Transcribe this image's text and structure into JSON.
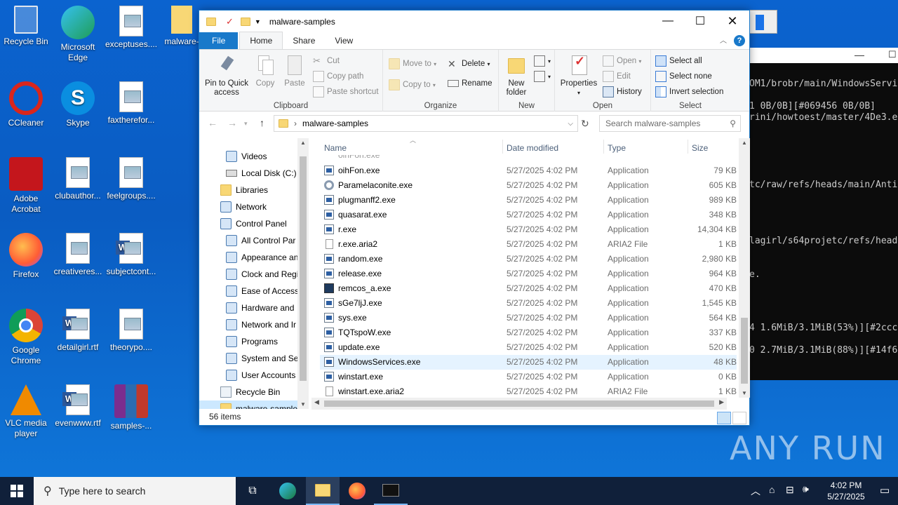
{
  "desktop": {
    "icons": [
      {
        "label": "Recycle Bin",
        "icon": "recycle-bin-icon"
      },
      {
        "label": "Microsoft Edge",
        "icon": "edge-icon"
      },
      {
        "label": "exceptuses....",
        "icon": "image-file-icon"
      },
      {
        "label": "malware-",
        "icon": "folder-icon"
      },
      {
        "label": "CCleaner",
        "icon": "ccleaner-icon"
      },
      {
        "label": "Skype",
        "icon": "skype-icon"
      },
      {
        "label": "faxtherefor...",
        "icon": "image-file-icon"
      },
      {
        "label": "Adobe Acrobat",
        "icon": "acrobat-icon"
      },
      {
        "label": "clubauthor...",
        "icon": "image-file-icon"
      },
      {
        "label": "feelgroups....",
        "icon": "image-file-icon"
      },
      {
        "label": "Firefox",
        "icon": "firefox-icon"
      },
      {
        "label": "creativeres...",
        "icon": "image-file-icon"
      },
      {
        "label": "subjectcont...",
        "icon": "word-doc-icon"
      },
      {
        "label": "Google Chrome",
        "icon": "chrome-icon"
      },
      {
        "label": "detailgirl.rtf",
        "icon": "word-doc-icon"
      },
      {
        "label": "theorypo....",
        "icon": "image-file-icon"
      },
      {
        "label": "VLC media player",
        "icon": "vlc-icon"
      },
      {
        "label": "evenwww.rtf",
        "icon": "word-doc-icon"
      },
      {
        "label": "samples-...",
        "icon": "winrar-icon"
      }
    ]
  },
  "terminal": {
    "lines": [
      "OM1/brobr/main/WindowsServi",
      "1 0B/0B][#069456 0B/0B]",
      "rini/howtoest/master/4De3.e",
      "tc/raw/refs/heads/main/Anti",
      "lagirl/s64projetc/refs/head",
      "e.",
      "4 1.6MiB/3.1MiB(53%)][#2ccc",
      "0 2.7MiB/3.1MiB(88%)][#14f6"
    ]
  },
  "explorer": {
    "title": "malware-samples",
    "tabs": [
      "File",
      "Home",
      "Share",
      "View"
    ],
    "ribbon": {
      "clipboard": {
        "label": "Clipboard",
        "pin": "Pin to Quick access",
        "copy": "Copy",
        "paste": "Paste",
        "cut": "Cut",
        "copy_path": "Copy path",
        "paste_shortcut": "Paste shortcut"
      },
      "organize": {
        "label": "Organize",
        "move_to": "Move to",
        "copy_to": "Copy to",
        "delete": "Delete",
        "rename": "Rename"
      },
      "new": {
        "label": "New",
        "new_folder": "New folder"
      },
      "open": {
        "label": "Open",
        "properties": "Properties",
        "open": "Open",
        "edit": "Edit",
        "history": "History"
      },
      "select": {
        "label": "Select",
        "select_all": "Select all",
        "select_none": "Select none",
        "invert": "Invert selection"
      }
    },
    "address": {
      "path": "malware-samples",
      "search_placeholder": "Search malware-samples"
    },
    "nav": [
      {
        "label": "Videos",
        "indent": 1,
        "icon": "videos-icon"
      },
      {
        "label": "Local Disk (C:)",
        "indent": 1,
        "icon": "drive-icon"
      },
      {
        "label": "Libraries",
        "indent": 0,
        "icon": "libraries-icon"
      },
      {
        "label": "Network",
        "indent": 0,
        "icon": "network-icon"
      },
      {
        "label": "Control Panel",
        "indent": 0,
        "icon": "control-panel-icon"
      },
      {
        "label": "All Control Par",
        "indent": 1,
        "icon": "control-panel-icon"
      },
      {
        "label": "Appearance an",
        "indent": 1,
        "icon": "appearance-icon"
      },
      {
        "label": "Clock and Regi",
        "indent": 1,
        "icon": "clock-icon"
      },
      {
        "label": "Ease of Access",
        "indent": 1,
        "icon": "ease-of-access-icon"
      },
      {
        "label": "Hardware and",
        "indent": 1,
        "icon": "hardware-icon"
      },
      {
        "label": "Network and Ir",
        "indent": 1,
        "icon": "network-icon"
      },
      {
        "label": "Programs",
        "indent": 1,
        "icon": "programs-icon"
      },
      {
        "label": "System and Sec",
        "indent": 1,
        "icon": "system-security-icon"
      },
      {
        "label": "User Accounts",
        "indent": 1,
        "icon": "user-accounts-icon"
      },
      {
        "label": "Recycle Bin",
        "indent": 0,
        "icon": "recycle-bin-icon"
      },
      {
        "label": "malware-sample",
        "indent": 0,
        "icon": "folder-icon",
        "selected": true
      }
    ],
    "columns": {
      "name": "Name",
      "date": "Date modified",
      "type": "Type",
      "size": "Size"
    },
    "files": [
      {
        "name": "oihFon.exe",
        "date": "5/27/2025 4:02 PM",
        "type": "Application",
        "size": "79 KB",
        "icon": "app"
      },
      {
        "name": "Paramelaconite.exe",
        "date": "5/27/2025 4:02 PM",
        "type": "Application",
        "size": "605 KB",
        "icon": "gear"
      },
      {
        "name": "plugmanff2.exe",
        "date": "5/27/2025 4:02 PM",
        "type": "Application",
        "size": "989 KB",
        "icon": "app"
      },
      {
        "name": "quasarat.exe",
        "date": "5/27/2025 4:02 PM",
        "type": "Application",
        "size": "348 KB",
        "icon": "app"
      },
      {
        "name": "r.exe",
        "date": "5/27/2025 4:02 PM",
        "type": "Application",
        "size": "14,304 KB",
        "icon": "app"
      },
      {
        "name": "r.exe.aria2",
        "date": "5/27/2025 4:02 PM",
        "type": "ARIA2 File",
        "size": "1 KB",
        "icon": "blank"
      },
      {
        "name": "random.exe",
        "date": "5/27/2025 4:02 PM",
        "type": "Application",
        "size": "2,980 KB",
        "icon": "app"
      },
      {
        "name": "release.exe",
        "date": "5/27/2025 4:02 PM",
        "type": "Application",
        "size": "964 KB",
        "icon": "app"
      },
      {
        "name": "remcos_a.exe",
        "date": "5/27/2025 4:02 PM",
        "type": "Application",
        "size": "470 KB",
        "icon": "mon"
      },
      {
        "name": "sGe7ljJ.exe",
        "date": "5/27/2025 4:02 PM",
        "type": "Application",
        "size": "1,545 KB",
        "icon": "app"
      },
      {
        "name": "sys.exe",
        "date": "5/27/2025 4:02 PM",
        "type": "Application",
        "size": "564 KB",
        "icon": "app"
      },
      {
        "name": "TQTspoW.exe",
        "date": "5/27/2025 4:02 PM",
        "type": "Application",
        "size": "337 KB",
        "icon": "app"
      },
      {
        "name": "update.exe",
        "date": "5/27/2025 4:02 PM",
        "type": "Application",
        "size": "520 KB",
        "icon": "app"
      },
      {
        "name": "WindowsServices.exe",
        "date": "5/27/2025 4:02 PM",
        "type": "Application",
        "size": "48 KB",
        "icon": "app",
        "selected": true
      },
      {
        "name": "winstart.exe",
        "date": "5/27/2025 4:02 PM",
        "type": "Application",
        "size": "0 KB",
        "icon": "app"
      },
      {
        "name": "winstart.exe.aria2",
        "date": "5/27/2025 4:02 PM",
        "type": "ARIA2 File",
        "size": "1 KB",
        "icon": "blank"
      }
    ],
    "status": "56 items"
  },
  "taskbar": {
    "search_placeholder": "Type here to search",
    "time": "4:02 PM",
    "date": "5/27/2025"
  },
  "watermark": "ANY RUN",
  "colors": {
    "accent": "#1979ca",
    "selection": "#e5f3ff",
    "desktop": "#0a5fc4",
    "taskbar": "#10203a"
  }
}
